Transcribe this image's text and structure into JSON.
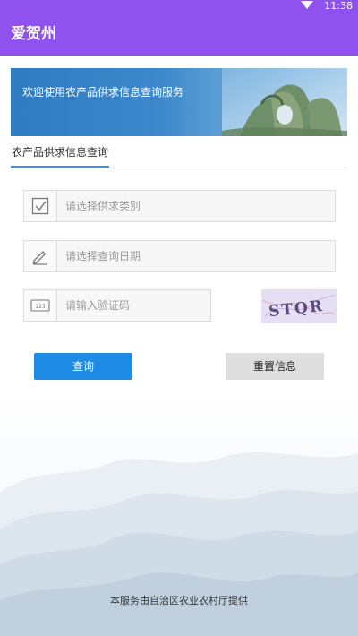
{
  "status_bar": {
    "time": "11:38",
    "wifi_icon": "wifi-icon"
  },
  "app_bar": {
    "title": "爱贺州"
  },
  "banner": {
    "text": "欢迎使用农产品供求信息查询服务"
  },
  "tabs": [
    {
      "label": "农产品供求信息查询"
    }
  ],
  "form": {
    "category": {
      "placeholder": "请选择供求类别",
      "icon": "checkbox-icon"
    },
    "date": {
      "placeholder": "请选择查询日期",
      "icon": "pencil-icon"
    },
    "captcha": {
      "placeholder": "请输入验证码",
      "icon": "number-keypad-icon",
      "image_text": "STQR"
    }
  },
  "buttons": {
    "query": "查询",
    "reset": "重置信息"
  },
  "footer": {
    "text": "本服务由自治区农业农村厅提供"
  },
  "colors": {
    "primary": "#8f52ee",
    "accent": "#1e8be6",
    "tab_underline": "#3b8fe6"
  }
}
